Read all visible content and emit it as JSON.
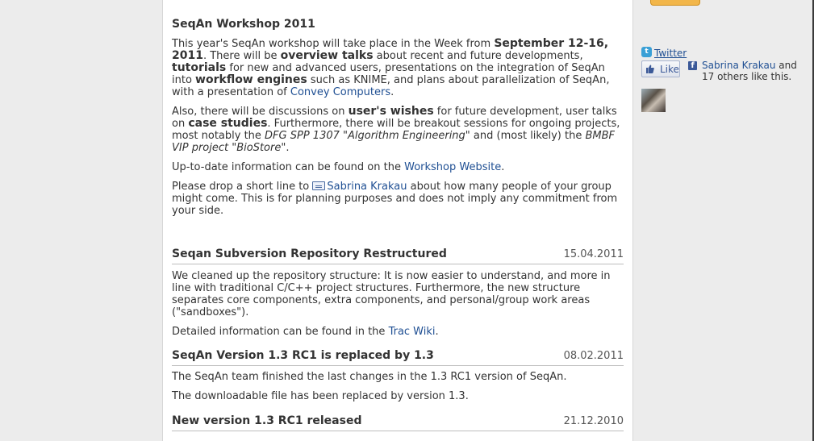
{
  "workshop": {
    "title": "SeqAn Workshop 2011",
    "p1": {
      "t1": "This year's SeqAn workshop will take place in the Week from ",
      "b1": "September 12-16, 2011",
      "t2": ". There will be ",
      "b2": "overview talks",
      "t3": " about recent and future developments, ",
      "b3": "tutorials",
      "t4": " for new and advanced users, presentations on the integration of SeqAn into ",
      "b4": "workflow engines",
      "t5": " such as KNIME, and plans about parallelization of SeqAn, with a presentation of ",
      "link": "Convey Computers",
      "t6": "."
    },
    "p2": {
      "t1": "Also, there will be discussions on ",
      "b1": "user's wishes",
      "t2": " for future development, user talks on ",
      "b2": "case studies",
      "t3": ". Furthermore, there will be breakout sessions for ongoing projects, most notably the ",
      "i1": "DFG SPP 1307 \"Algorithm Engineering\"",
      "t4": " and (most likely) the ",
      "i2": "BMBF VIP project \"BioStore\"",
      "t5": "."
    },
    "p3": {
      "t1": "Up-to-date information can be found on the ",
      "link": "Workshop Website",
      "t2": "."
    },
    "p4": {
      "t1": "Please drop a short line to ",
      "link": "Sabrina Krakau",
      "t2": " about how many people of your group might come. This is for planning purposes and does not imply any commitment from your side."
    }
  },
  "news": [
    {
      "title": "Seqan Subversion Repository Restructured",
      "date": "15.04.2011",
      "p1": "We cleaned up the repository structure: It is now easier to understand, and more in line with traditional C/C++ project structures. Furthermore, the new structure separates core components, extra components, and personal/group work areas (\"sandboxes\").",
      "p2_text": "Detailed information can be found in the ",
      "p2_link": "Trac Wiki",
      "p2_end": "."
    },
    {
      "title": "SeqAn Version 1.3 RC1 is replaced by 1.3",
      "date": "08.02.2011",
      "p1": "The SeqAn team finished the last changes in the 1.3 RC1 version of SeqAn.",
      "p2": "The downloadable file has been replaced by version 1.3."
    },
    {
      "title": "New version 1.3 RC1 released",
      "date": "21.12.2010"
    }
  ],
  "sidebar": {
    "twitter_label": "Twitter",
    "like_label": "Like",
    "fb_name": "Sabrina Krakau",
    "fb_rest": " and 17 others like this."
  }
}
